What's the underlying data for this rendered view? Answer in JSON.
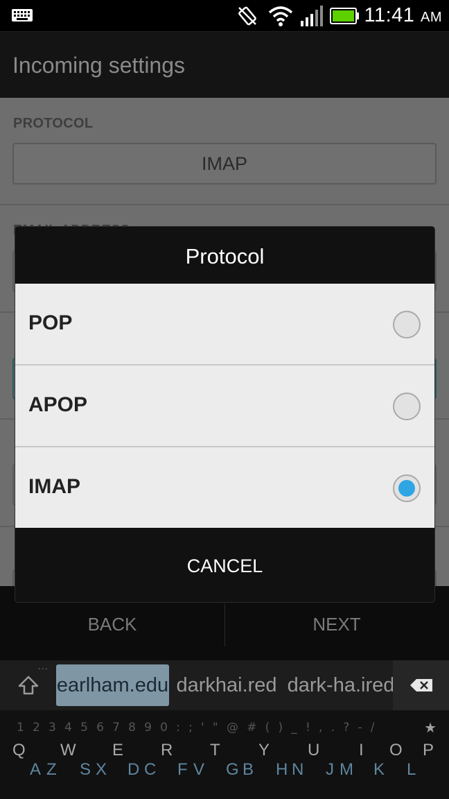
{
  "status_bar": {
    "time": "11:41",
    "ampm": "AM",
    "battery_color": "#5cd000"
  },
  "action_bar": {
    "title": "Incoming settings"
  },
  "settings": {
    "protocol_label": "PROTOCOL",
    "protocol_value": "IMAP",
    "email_label": "EMAIL ADDRESS"
  },
  "nav": {
    "back": "BACK",
    "next": "NEXT"
  },
  "suggestions": {
    "dots": "...",
    "items": [
      "earlham.edu",
      "darkhai.red",
      "dark-ha.ired"
    ],
    "selected_index": 0
  },
  "keyboard": {
    "number_row": "1 2 3 4 5 6 7 8 9 0 : ; ' \" @ # ( ) _ ! , . ? - /",
    "star": "★",
    "upper_row": [
      "Q",
      "W",
      "E",
      "R",
      "T",
      "Y",
      "U",
      "I",
      "O",
      "P"
    ],
    "lower_row": [
      "A",
      "Z",
      "S",
      "X",
      "D",
      "C",
      "F",
      "V",
      "G",
      "B",
      "H",
      "N",
      "J",
      "M",
      "K",
      "L"
    ],
    "accent_color": "#5f86a0"
  },
  "dialog": {
    "title": "Protocol",
    "options": [
      {
        "label": "POP",
        "selected": false
      },
      {
        "label": "APOP",
        "selected": false
      },
      {
        "label": "IMAP",
        "selected": true
      }
    ],
    "cancel": "CANCEL",
    "radio_color": "#2fa6e3"
  }
}
